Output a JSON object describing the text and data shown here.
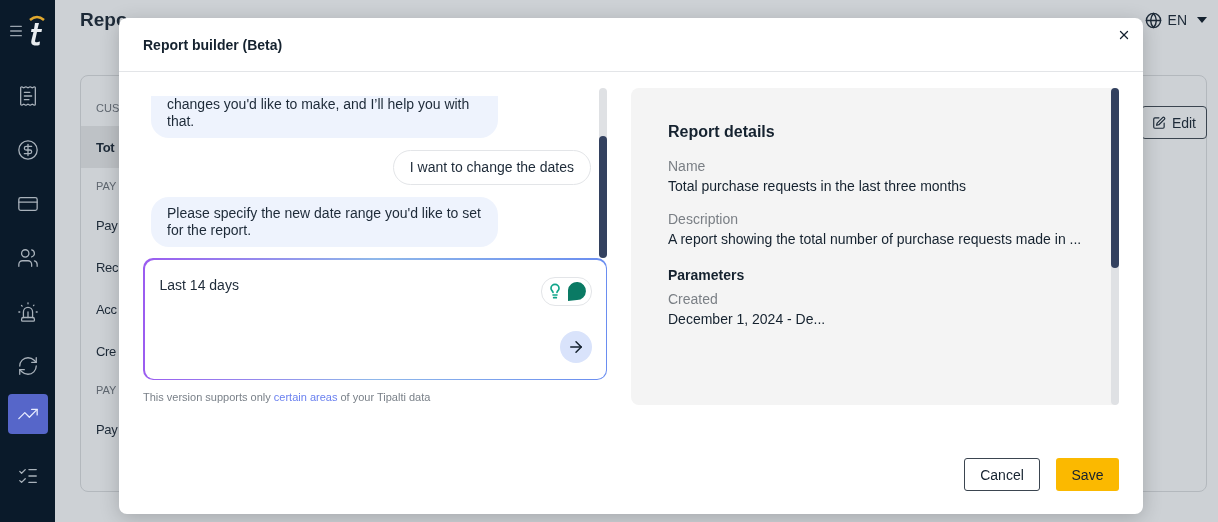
{
  "sidebar": {
    "items": [
      {
        "selected": false
      },
      {
        "selected": false
      },
      {
        "selected": false
      },
      {
        "selected": false
      },
      {
        "selected": false
      },
      {
        "selected": false
      },
      {
        "selected": true
      },
      {
        "selected": false
      }
    ]
  },
  "page": {
    "title": "Repo",
    "language": "EN",
    "edit_button": "Edit",
    "list": [
      {
        "kind": "section",
        "label": "CUS"
      },
      {
        "kind": "item",
        "label": "Tot",
        "selected": true
      },
      {
        "kind": "section",
        "label": "PAY"
      },
      {
        "kind": "item",
        "label": "Pay",
        "selected": false
      },
      {
        "kind": "item",
        "label": "Rec",
        "selected": false
      },
      {
        "kind": "item",
        "label": "Acc",
        "selected": false
      },
      {
        "kind": "item",
        "label": "Cre",
        "selected": false
      },
      {
        "kind": "section",
        "label": "PAY"
      },
      {
        "kind": "item",
        "label": "Pay",
        "selected": false
      }
    ]
  },
  "dialog": {
    "title": "Report builder (Beta)",
    "messages": [
      {
        "kind": "bot",
        "text": "changes you'd like to make, and I’ll help you with that."
      },
      {
        "kind": "user",
        "text": "I want to change the dates"
      },
      {
        "kind": "bot",
        "text": "Please specify the new date range you'd like to set for the report."
      }
    ],
    "input": {
      "value": "Last 14 days"
    },
    "footnote": {
      "before": "This version supports only ",
      "link": "certain areas",
      "after": " of your Tipalti data"
    },
    "details": {
      "title": "Report details",
      "fields": [
        {
          "label": "Name",
          "value": "Total purchase requests in the last three months"
        },
        {
          "label": "Description",
          "value": "A report showing the total number of purchase requests made in ..."
        }
      ],
      "parameters_title": "Parameters",
      "parameters": [
        {
          "label": "Created",
          "value": "December 1, 2024 - De..."
        }
      ]
    },
    "buttons": {
      "cancel": "Cancel",
      "save": "Save"
    }
  }
}
